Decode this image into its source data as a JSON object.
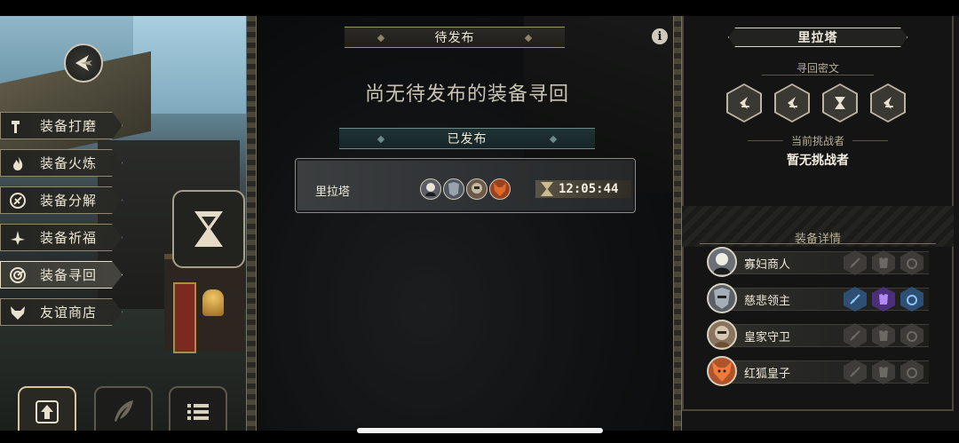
{
  "left_menu": {
    "items": [
      {
        "label": "装备打磨",
        "icon": "hammer-icon"
      },
      {
        "label": "装备火炼",
        "icon": "flame-icon"
      },
      {
        "label": "装备分解",
        "icon": "dismantle-icon"
      },
      {
        "label": "装备祈福",
        "icon": "prayer-icon"
      },
      {
        "label": "装备寻回",
        "icon": "retrieve-icon",
        "active": true
      },
      {
        "label": "友谊商店",
        "icon": "fox-shop-icon"
      }
    ]
  },
  "bottom_nav": [
    "upgrade-arrow-icon",
    "feather-icon",
    "list-icon"
  ],
  "center": {
    "pending_header": "待发布",
    "empty_message": "尚无待发布的装备寻回",
    "published_header": "已发布",
    "published_entry": {
      "name": "里拉塔",
      "timer": "12:05:44",
      "heroes": [
        "寡妇商人",
        "慈悲领主",
        "皇家守卫",
        "红狐皇子"
      ]
    },
    "info_icon": "i"
  },
  "right_panel": {
    "title": "里拉塔",
    "cipher_label": "寻回密文",
    "cipher_symbols": [
      "rune-left-icon",
      "rune-left-icon",
      "rune-hourglass-icon",
      "rune-left-icon"
    ],
    "challenger_label": "当前挑战者",
    "challenger_value": "暂无挑战者",
    "details_label": "装备详情",
    "heroes": [
      {
        "name": "寡妇商人",
        "slots_active": [
          false,
          false,
          false
        ],
        "color": "#6b6f78"
      },
      {
        "name": "慈悲领主",
        "slots_active": [
          true,
          true,
          true
        ],
        "color": "#59606a"
      },
      {
        "name": "皇家守卫",
        "slots_active": [
          false,
          false,
          false
        ],
        "color": "#8a7460"
      },
      {
        "name": "红狐皇子",
        "slots_active": [
          false,
          false,
          false
        ],
        "color": "#b0522a"
      }
    ]
  },
  "colors": {
    "accent_gold": "#d8c69a",
    "active_blue": "#4f8fd8",
    "active_purple": "#7a4fc0",
    "panel_dark": "#141414"
  }
}
